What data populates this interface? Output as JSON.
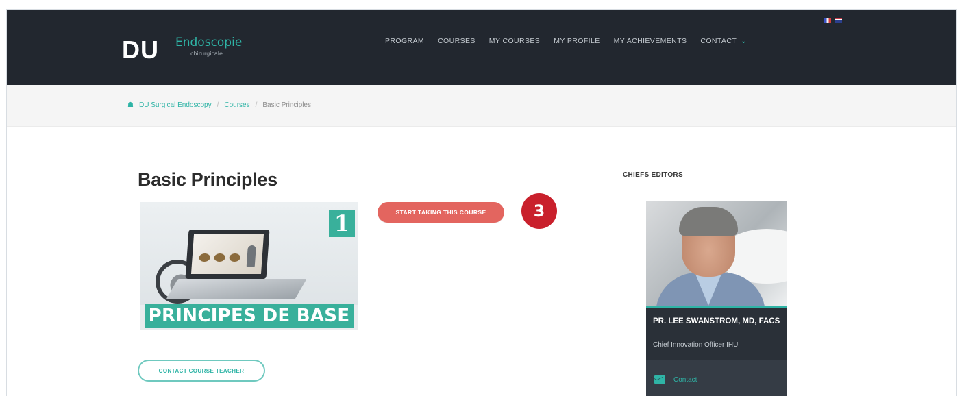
{
  "header": {
    "logo_main": "DU",
    "logo_sub": "Endoscopie",
    "logo_small": "chirurgicale",
    "nav": [
      {
        "label": "PROGRAM"
      },
      {
        "label": "COURSES"
      },
      {
        "label": "MY COURSES"
      },
      {
        "label": "MY PROFILE"
      },
      {
        "label": "MY ACHIEVEMENTS"
      },
      {
        "label": "CONTACT"
      }
    ],
    "languages": [
      "fr",
      "en"
    ]
  },
  "breadcrumb": {
    "home": "DU Surgical Endoscopy",
    "separator": "/",
    "courses": "Courses",
    "current": "Basic Principles"
  },
  "course": {
    "title": "Basic Principles",
    "image_number": "1",
    "image_caption": "PRINCIPES DE BASE",
    "start_button": "START TAKING THIS COURSE",
    "contact_button": "CONTACT COURSE TEACHER",
    "step_badge": "3"
  },
  "sidebar": {
    "title": "CHIEFS EDITORS",
    "editor": {
      "name": "PR. LEE SWANSTROM, MD, FACS",
      "role": "Chief Innovation Officer IHU",
      "contact_label": "Contact"
    }
  },
  "colors": {
    "navbar": "#22272f",
    "accent": "#2fb4a6",
    "start_button": "#e3655f",
    "step_badge": "#c9202c"
  }
}
